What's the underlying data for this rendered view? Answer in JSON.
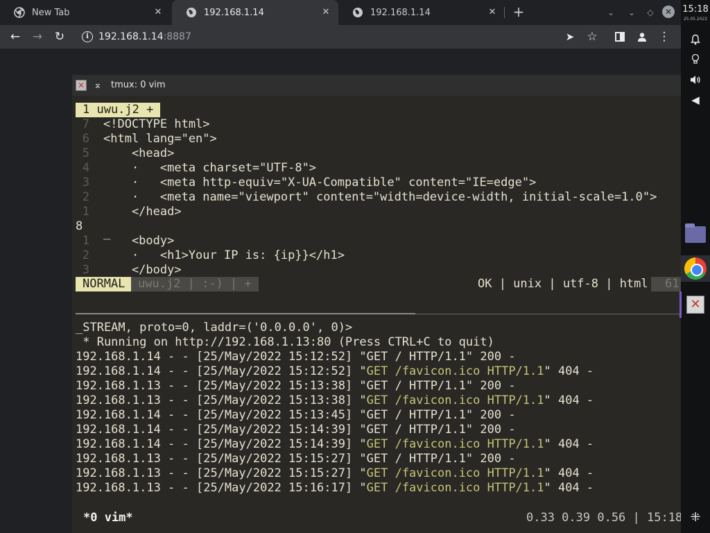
{
  "tabs": [
    {
      "title": "New Tab",
      "favicon": "chrome-icon",
      "active": false
    },
    {
      "title": "192.168.1.14",
      "favicon": "globe-icon",
      "active": true
    },
    {
      "title": "192.168.1.14",
      "favicon": "globe-icon",
      "active": false
    }
  ],
  "toolbar": {
    "url_host": "192.168.1.14",
    "url_port": ":8887"
  },
  "terminal": {
    "title": "tmux: 0 vim",
    "vim_tab": "1 uwu.j2 +",
    "lines": [
      {
        "num": "7",
        "text": "<!DOCTYPE html>"
      },
      {
        "num": "6",
        "text": "<html lang=\"en\">"
      },
      {
        "num": "5",
        "text": "    <head>"
      },
      {
        "num": "4",
        "text": "    ·   <meta charset=\"UTF-8\">"
      },
      {
        "num": "3",
        "text": "    ·   <meta http-equiv=\"X-UA-Compatible\" content=\"IE=edge\">"
      },
      {
        "num": "2",
        "text": "    ·   <meta name=\"viewport\" content=\"width=device-width, initial-scale=1.0\">"
      },
      {
        "num": "1",
        "text": "    </head>"
      },
      {
        "num": "8",
        "text": "_"
      },
      {
        "num": "1",
        "text": "    <body>"
      },
      {
        "num": "2",
        "text": "    ·   <h1>Your IP is: {ip}}</h1>"
      },
      {
        "num": "3",
        "text": "    </body>"
      }
    ],
    "status": {
      "mode": "NORMAL",
      "fileinfo": "uwu.j2 | :-) | +",
      "right": "OK | unix | utf-8 | html",
      "pos": "61"
    },
    "log": [
      {
        "pre": "_STREAM, proto=0, laddr=('0.0.0.0', 0)>",
        "req": "",
        "post": ""
      },
      {
        "pre": " * Running on http://192.168.1.13:80 (Press CTRL+C to quit)",
        "req": "",
        "post": ""
      },
      {
        "pre": "192.168.1.14 - - [25/May/2022 15:12:52] \"GET / HTTP/1.1\" 200 -",
        "req": "",
        "post": ""
      },
      {
        "pre": "192.168.1.14 - - [25/May/2022 15:12:52] \"",
        "req": "GET /favicon.ico HTTP/1.1",
        "post": "\" 404 -"
      },
      {
        "pre": "192.168.1.13 - - [25/May/2022 15:13:38] \"GET / HTTP/1.1\" 200 -",
        "req": "",
        "post": ""
      },
      {
        "pre": "192.168.1.13 - - [25/May/2022 15:13:38] \"",
        "req": "GET /favicon.ico HTTP/1.1",
        "post": "\" 404 -"
      },
      {
        "pre": "192.168.1.14 - - [25/May/2022 15:13:45] \"GET / HTTP/1.1\" 200 -",
        "req": "",
        "post": ""
      },
      {
        "pre": "192.168.1.14 - - [25/May/2022 15:14:39] \"GET / HTTP/1.1\" 200 -",
        "req": "",
        "post": ""
      },
      {
        "pre": "192.168.1.14 - - [25/May/2022 15:14:39] \"",
        "req": "GET /favicon.ico HTTP/1.1",
        "post": "\" 404 -"
      },
      {
        "pre": "192.168.1.13 - - [25/May/2022 15:15:27] \"GET / HTTP/1.1\" 200 -",
        "req": "",
        "post": ""
      },
      {
        "pre": "192.168.1.13 - - [25/May/2022 15:15:27] \"",
        "req": "GET /favicon.ico HTTP/1.1",
        "post": "\" 404 -"
      },
      {
        "pre": "192.168.1.13 - - [25/May/2022 15:16:17] \"",
        "req": "GET /favicon.ico HTTP/1.1",
        "post": "\" 404 -"
      }
    ],
    "tmux_window": "*0 vim*",
    "tmux_right": "0.33 0.39 0.56 | 15:18"
  },
  "panel": {
    "time": "15:18",
    "date": "25.05.2022"
  },
  "colors": {
    "vim_accent": "#e8e5ae",
    "log_request": "#c7c476",
    "browser_bg": "#202124"
  }
}
